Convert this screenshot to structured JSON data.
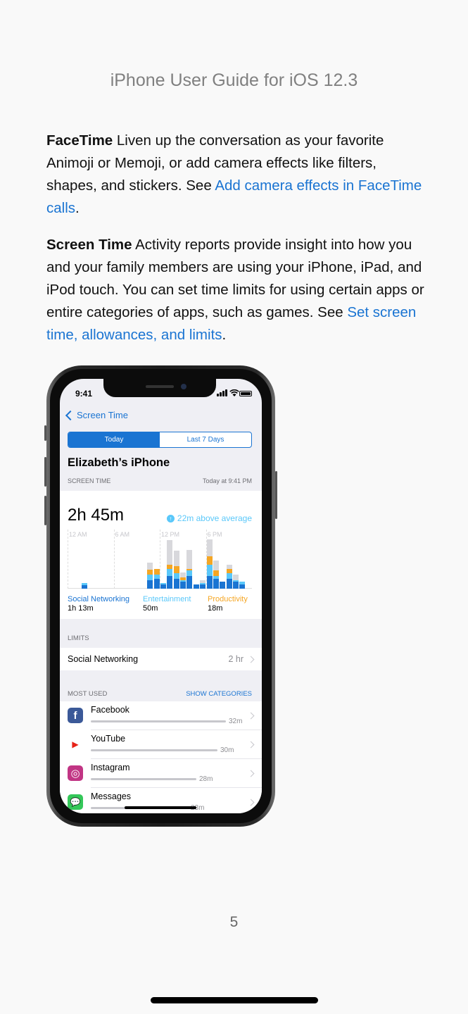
{
  "header": {
    "title": "iPhone User Guide for iOS 12.3"
  },
  "paragraphs": {
    "facetime": {
      "lead": "FaceTime",
      "text": " Liven up the conversation as your favorite Animoji or Memoji, or add camera effects like filters, shapes, and stickers. See ",
      "link": "Add camera effects in FaceTime calls",
      "end": "."
    },
    "screentime": {
      "lead": "Screen Time",
      "text": " Activity reports provide insight into how you and your family members are using your iPhone, iPad, and iPod touch. You can set time limits for using certain apps or entire categories of apps, such as games. See ",
      "link": "Set screen time, allowances, and limits",
      "end": "."
    }
  },
  "phone": {
    "status_time": "9:41",
    "back_label": "Screen Time",
    "segments": {
      "today": "Today",
      "last7": "Last 7 Days"
    },
    "device_name": "Elizabeth’s iPhone",
    "section_screen_time": "SCREEN TIME",
    "timestamp": "Today at 9:41 PM",
    "total": "2h 45m",
    "average_note": "22m above average",
    "chart_ticks": [
      "12 AM",
      "6 AM",
      "12 PM",
      "6 PM"
    ],
    "colors": {
      "social": "#1a74d2",
      "entertainment": "#5ac8fa",
      "productivity": "#f5a623",
      "other": "#d8d8dc"
    },
    "hourly": [
      [
        0,
        0,
        0,
        0
      ],
      [
        0,
        0,
        0,
        0
      ],
      [
        5,
        3,
        0,
        0
      ],
      [
        0,
        0,
        0,
        0
      ],
      [
        0,
        0,
        0,
        0
      ],
      [
        0,
        0,
        0,
        0
      ],
      [
        0,
        0,
        0,
        0
      ],
      [
        0,
        0,
        0,
        0
      ],
      [
        0,
        0,
        0,
        0
      ],
      [
        0,
        0,
        0,
        0
      ],
      [
        0,
        0,
        0,
        0
      ],
      [
        0,
        0,
        0,
        0
      ],
      [
        12,
        8,
        7,
        10
      ],
      [
        14,
        6,
        8,
        0
      ],
      [
        6,
        2,
        0,
        0
      ],
      [
        18,
        10,
        6,
        35
      ],
      [
        14,
        8,
        10,
        22
      ],
      [
        10,
        2,
        4,
        7
      ],
      [
        18,
        8,
        2,
        27
      ],
      [
        6,
        0,
        0,
        0
      ],
      [
        6,
        2,
        0,
        4
      ],
      [
        18,
        16,
        12,
        24
      ],
      [
        14,
        4,
        8,
        14
      ],
      [
        10,
        0,
        0,
        0
      ],
      [
        14,
        8,
        6,
        6
      ],
      [
        10,
        2,
        0,
        8
      ],
      [
        6,
        4,
        0,
        0
      ],
      [
        0,
        0,
        0,
        0
      ]
    ],
    "legend": [
      {
        "name": "Social Networking",
        "value": "1h 13m",
        "color": "#1a74d2"
      },
      {
        "name": "Entertainment",
        "value": "50m",
        "color": "#5ac8fa"
      },
      {
        "name": "Productivity",
        "value": "18m",
        "color": "#f5a623"
      }
    ],
    "section_limits": "LIMITS",
    "limit": {
      "label": "Social Networking",
      "value": "2 hr"
    },
    "section_most_used": "MOST USED",
    "show_categories": "SHOW CATEGORIES",
    "apps": [
      {
        "name": "Facebook",
        "time": "32m",
        "fraction": 1.0,
        "icon": "facebook-icon",
        "color": "#3b5998",
        "glyph": "f"
      },
      {
        "name": "YouTube",
        "time": "30m",
        "fraction": 0.94,
        "icon": "youtube-icon",
        "color": "#ffffff",
        "glyph": "▶"
      },
      {
        "name": "Instagram",
        "time": "28m",
        "fraction": 0.78,
        "icon": "instagram-icon",
        "color": "#c13584",
        "glyph": "◎"
      },
      {
        "name": "Messages",
        "time": "23m",
        "fraction": 0.72,
        "icon": "messages-icon",
        "color": "#34c759",
        "glyph": "💬"
      }
    ]
  },
  "page_number": "5"
}
